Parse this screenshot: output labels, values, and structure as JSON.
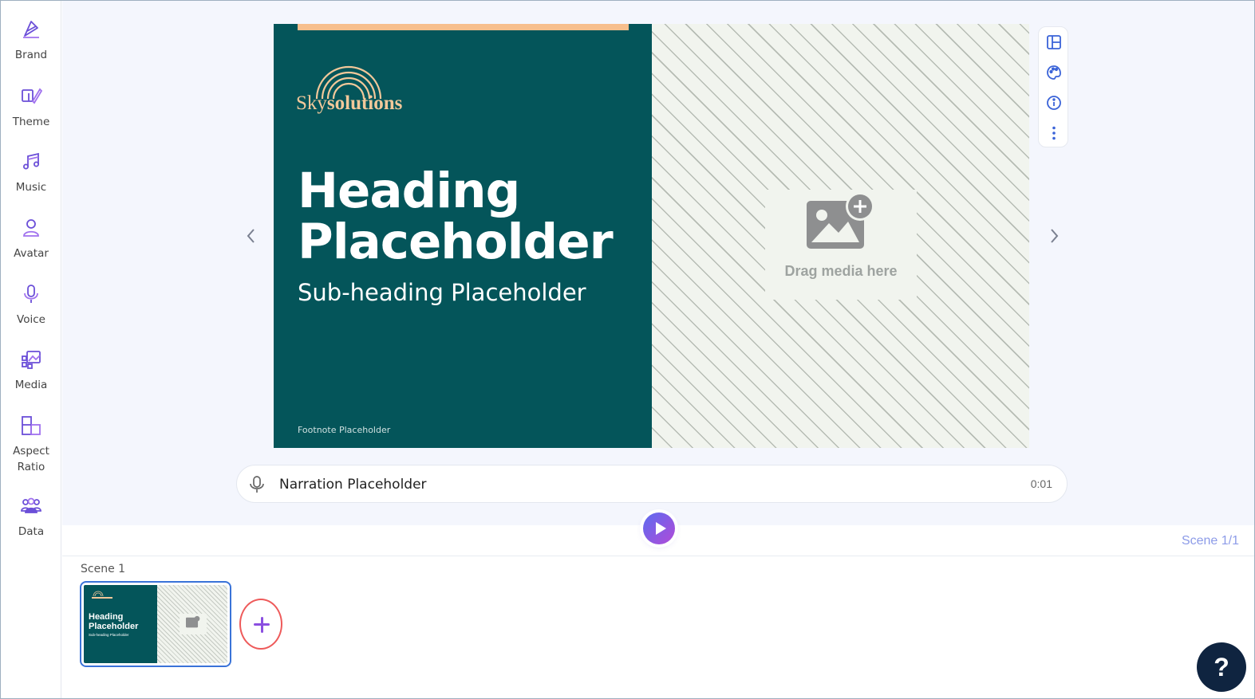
{
  "sidebar": {
    "items": [
      {
        "label": "Brand",
        "icon": "brand-icon"
      },
      {
        "label": "Theme",
        "icon": "theme-icon"
      },
      {
        "label": "Music",
        "icon": "music-icon"
      },
      {
        "label": "Avatar",
        "icon": "avatar-icon"
      },
      {
        "label": "Voice",
        "icon": "microphone-icon"
      },
      {
        "label": "Media",
        "icon": "media-icon"
      },
      {
        "label": "Aspect Ratio",
        "icon": "aspect-ratio-icon"
      },
      {
        "label": "Data",
        "icon": "data-icon"
      }
    ]
  },
  "slide": {
    "logo_light": "Sky",
    "logo_bold": "solutions",
    "heading_line1": "Heading",
    "heading_line2": "Placeholder",
    "subheading": "Sub-heading Placeholder",
    "footnote": "Footnote Placeholder",
    "drop_text": "Drag media here",
    "colors": {
      "panel": "#04555a",
      "accent": "#f7bf8d",
      "pattern": "#f1f4ee"
    }
  },
  "toolbar": {
    "icons": [
      "layout-icon",
      "palette-icon",
      "info-icon",
      "more-vertical-icon"
    ]
  },
  "narration": {
    "text": "Narration Placeholder",
    "time": "0:01"
  },
  "timeline": {
    "scene_count": "Scene 1/1",
    "scene_label": "Scene 1",
    "thumb_heading_line1": "Heading",
    "thumb_heading_line2": "Placeholder",
    "thumb_sub": "Sub-heading Placeholder"
  },
  "help": {
    "label": "?"
  }
}
